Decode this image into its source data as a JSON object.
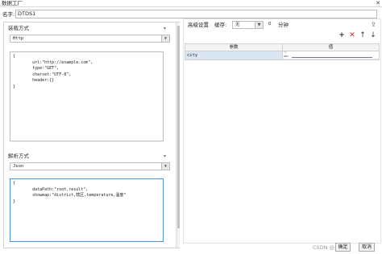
{
  "window": {
    "title": "数据工厂",
    "close_glyph": "✕"
  },
  "name_field": {
    "label": "名字:",
    "value": "DTDS1"
  },
  "loading": {
    "section_title": "装载方式",
    "collapse_glyph": "▾",
    "selected": "Http",
    "config_lines": [
      "{",
      "        url:\"http://example.com\",",
      "        type:\"GET\",",
      "        charset:\"UTF-8\",",
      "        header:{}",
      "}"
    ]
  },
  "parsing": {
    "section_title": "解析方式",
    "collapse_glyph": "▾",
    "selected": "Json",
    "config_lines": [
      "{",
      "        dataPath:\"root.result\",",
      "        showmap:\"district,辖区,temperature,温度\"",
      "}"
    ]
  },
  "advanced": {
    "label": "高级设置",
    "cache_label": "缓存:",
    "cache_value": "无",
    "duration_value": "0",
    "duration_unit": "分钟",
    "export_icon_glyph": "⇪"
  },
  "param_toolbar": {
    "add_glyph": "+",
    "delete_glyph": "✕",
    "move_up_glyph": "↑",
    "move_down_glyph": "↓"
  },
  "param_table": {
    "columns": [
      "参数",
      "值"
    ],
    "rows": [
      {
        "param": "city",
        "value": ""
      }
    ],
    "cell_icon_text": "ᴬᵇ\nabc"
  },
  "footer": {
    "watermark": "CSDN @此",
    "watermark_tail": "年",
    "confirm_label": "确定",
    "cancel_label": "取消"
  },
  "colors": {
    "delete_red": "#e02020",
    "add_dark": "#333333",
    "selected_row": "#dbe6f3",
    "focus_blue": "#4a90d9"
  }
}
